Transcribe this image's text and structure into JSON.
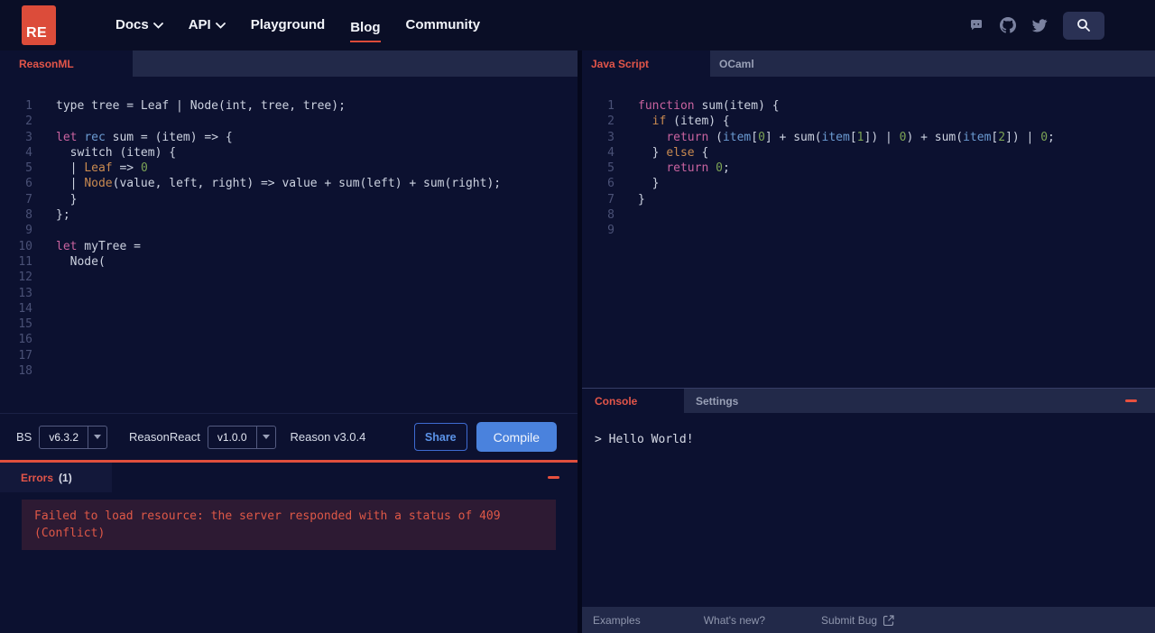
{
  "nav": {
    "logo_text": "RE",
    "links": [
      {
        "label": "Docs",
        "chevron": true,
        "active": false
      },
      {
        "label": "API",
        "chevron": true,
        "active": false
      },
      {
        "label": "Playground",
        "chevron": false,
        "active": false
      },
      {
        "label": "Blog",
        "chevron": false,
        "active": true
      },
      {
        "label": "Community",
        "chevron": false,
        "active": false
      }
    ],
    "icons": [
      "discord-icon",
      "github-icon",
      "twitter-icon",
      "search-icon"
    ]
  },
  "left": {
    "tab_label": "ReasonML",
    "editor": {
      "language": "ReasonML",
      "lines": [
        {
          "n": "1",
          "s": [
            [
              "d",
              "type tree = Leaf | Node(int, tree, tree);"
            ]
          ]
        },
        {
          "n": "2",
          "s": []
        },
        {
          "n": "3",
          "s": [
            [
              "k",
              "let"
            ],
            [
              "d",
              " "
            ],
            [
              "b",
              "rec"
            ],
            [
              "d",
              " sum = (item) => {"
            ]
          ]
        },
        {
          "n": "4",
          "s": [
            [
              "d",
              "  switch (item) {"
            ]
          ]
        },
        {
          "n": "5",
          "s": [
            [
              "d",
              "  | "
            ],
            [
              "o",
              "Leaf"
            ],
            [
              "d",
              " => "
            ],
            [
              "g",
              "0"
            ]
          ]
        },
        {
          "n": "6",
          "s": [
            [
              "d",
              "  | "
            ],
            [
              "o",
              "Node"
            ],
            [
              "d",
              "(value, left, right) => value + sum(left) + sum(right);"
            ]
          ]
        },
        {
          "n": "7",
          "s": [
            [
              "d",
              "  }"
            ]
          ]
        },
        {
          "n": "8",
          "s": [
            [
              "d",
              "};"
            ]
          ]
        },
        {
          "n": "9",
          "s": []
        },
        {
          "n": "10",
          "s": [
            [
              "k",
              "let"
            ],
            [
              "d",
              " myTree ="
            ]
          ]
        },
        {
          "n": "11",
          "s": [
            [
              "d",
              "  Node("
            ]
          ]
        },
        {
          "n": "12",
          "s": []
        },
        {
          "n": "13",
          "s": []
        },
        {
          "n": "14",
          "s": []
        },
        {
          "n": "15",
          "s": []
        },
        {
          "n": "16",
          "s": []
        },
        {
          "n": "17",
          "s": []
        },
        {
          "n": "18",
          "s": []
        }
      ]
    },
    "toolbar": {
      "bs_label": "BS",
      "bs_version": "v6.3.2",
      "reasonreact_label": "ReasonReact",
      "reasonreact_version": "v1.0.0",
      "reason_version": "Reason v3.0.4",
      "share_label": "Share",
      "compile_label": "Compile"
    },
    "errors": {
      "title": "Errors",
      "count": "(1)",
      "message": "Failed to load resource: the server responded with a status of 409 (Conflict)"
    }
  },
  "right": {
    "tabs": {
      "javascript": "Java Script",
      "ocaml": "OCaml"
    },
    "editor": {
      "language": "JavaScript",
      "lines": [
        {
          "n": "1",
          "s": [
            [
              "k",
              "function"
            ],
            [
              "d",
              " sum(item) {"
            ]
          ]
        },
        {
          "n": "2",
          "s": [
            [
              "d",
              "  "
            ],
            [
              "o",
              "if"
            ],
            [
              "d",
              " (item) {"
            ]
          ]
        },
        {
          "n": "3",
          "s": [
            [
              "d",
              "    "
            ],
            [
              "k",
              "return"
            ],
            [
              "d",
              " ("
            ],
            [
              "b",
              "item"
            ],
            [
              "d",
              "["
            ],
            [
              "g",
              "0"
            ],
            [
              "d",
              "] + sum("
            ],
            [
              "b",
              "item"
            ],
            [
              "d",
              "["
            ],
            [
              "g",
              "1"
            ],
            [
              "d",
              "]) | "
            ],
            [
              "g",
              "0"
            ],
            [
              "d",
              ") + sum("
            ],
            [
              "b",
              "item"
            ],
            [
              "d",
              "["
            ],
            [
              "g",
              "2"
            ],
            [
              "d",
              "]) | "
            ],
            [
              "g",
              "0"
            ],
            [
              "d",
              ";"
            ]
          ]
        },
        {
          "n": "4",
          "s": [
            [
              "d",
              "  } "
            ],
            [
              "o",
              "else"
            ],
            [
              "d",
              " {"
            ]
          ]
        },
        {
          "n": "5",
          "s": [
            [
              "d",
              "    "
            ],
            [
              "k",
              "return"
            ],
            [
              "d",
              " "
            ],
            [
              "g",
              "0"
            ],
            [
              "d",
              ";"
            ]
          ]
        },
        {
          "n": "6",
          "s": [
            [
              "d",
              "  }"
            ]
          ]
        },
        {
          "n": "7",
          "s": [
            [
              "d",
              "}"
            ]
          ]
        },
        {
          "n": "8",
          "s": []
        },
        {
          "n": "9",
          "s": []
        }
      ]
    },
    "console": {
      "tab_label": "Console",
      "settings_label": "Settings",
      "output": "> Hello World!"
    },
    "footer": {
      "examples": "Examples",
      "whats_new": "What's new?",
      "submit_bug": "Submit Bug"
    }
  },
  "colors": {
    "accent_red": "#dc4c3a",
    "red_text": "#e25549",
    "compile_blue": "#4a82dd",
    "panel_dark": "#0c1130",
    "tabbar_light": "#222949",
    "error_box_bg": "#2d1a33"
  }
}
